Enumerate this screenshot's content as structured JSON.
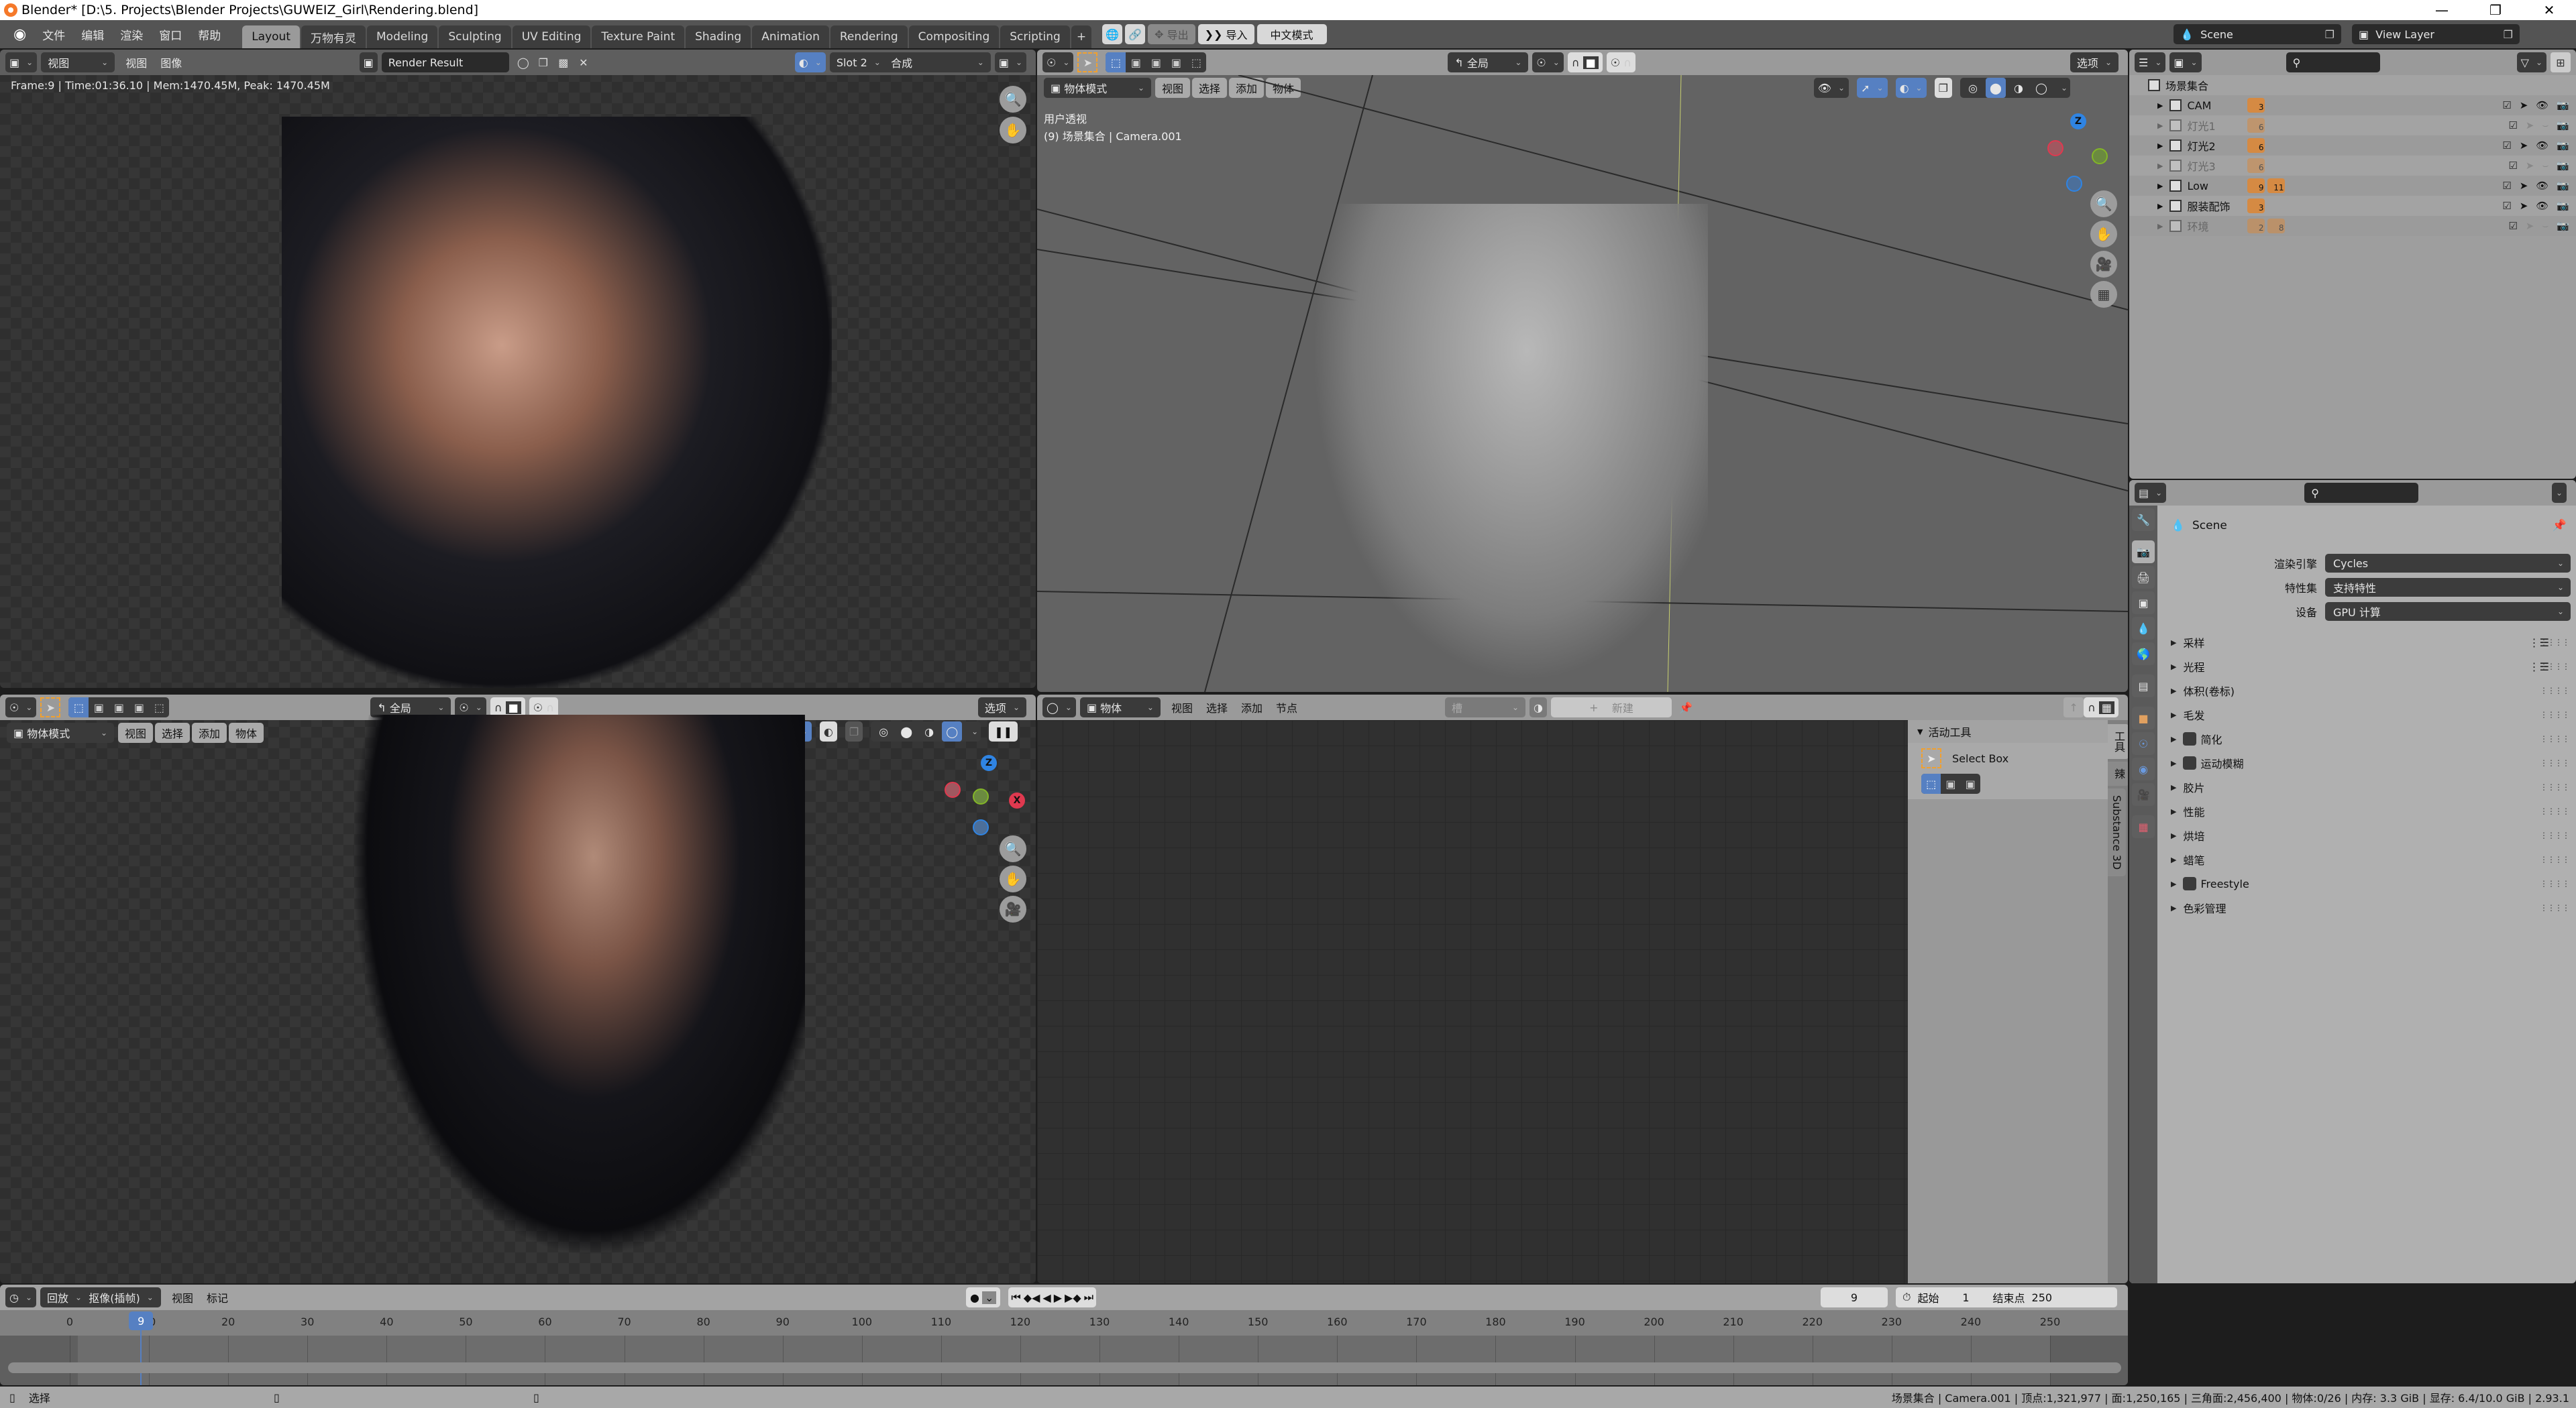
{
  "window": {
    "title": "Blender* [D:\\5. Projects\\Blender Projects\\GUWEIZ_Girl\\Rendering.blend]",
    "controls": [
      "minimize",
      "restore",
      "close"
    ]
  },
  "topbar": {
    "menus": [
      "文件",
      "编辑",
      "渲染",
      "窗口",
      "帮助"
    ],
    "workspaces": [
      "Layout",
      "万物有灵",
      "Modeling",
      "Sculpting",
      "UV Editing",
      "Texture Paint",
      "Shading",
      "Animation",
      "Rendering",
      "Compositing",
      "Scripting"
    ],
    "active_workspace": "Layout",
    "add_tab": "+",
    "export_label": "导出",
    "import_label": "导入",
    "chinese_mode_label": "中文模式",
    "scene": "Scene",
    "view_layer": "View Layer"
  },
  "image_editor": {
    "view_mode": "视图",
    "menus": [
      "视图",
      "图像"
    ],
    "image_name": "Render Result",
    "slot": "Slot 2",
    "layer": "合成",
    "render_info": "Frame:9 | Time:01:36.10 | Mem:1470.45M, Peak: 1470.45M"
  },
  "viewport_top": {
    "orientation": "全局",
    "options_label": "选项",
    "mode": "物体模式",
    "menus": [
      "视图",
      "选择",
      "添加",
      "物体"
    ],
    "view_name": "用户透视",
    "view_info": "(9) 场景集合 | Camera.001",
    "gizmo_axes": [
      "Z",
      "X",
      "Y"
    ]
  },
  "viewport_bottom": {
    "orientation": "全局",
    "options_label": "选项",
    "mode": "物体模式",
    "menus": [
      "视图",
      "选择",
      "添加",
      "物体"
    ],
    "gizmo_axes": [
      "Z",
      "X",
      "Y"
    ]
  },
  "shader_editor": {
    "type": "物体",
    "menus": [
      "视图",
      "选择",
      "添加",
      "节点"
    ],
    "slot_placeholder": "槽",
    "new_label": "新建",
    "sidebar": {
      "panel_title": "活动工具",
      "tool_name": "Select Box",
      "tabs": [
        "工具",
        "辣",
        "Substance 3D"
      ]
    }
  },
  "outliner": {
    "root": "场景集合",
    "rows": [
      {
        "name": "CAM",
        "dim": false,
        "badges": [
          "3"
        ]
      },
      {
        "name": "灯光1",
        "dim": true,
        "badges": [
          "6"
        ]
      },
      {
        "name": "灯光2",
        "dim": false,
        "badges": [
          "6"
        ]
      },
      {
        "name": "灯光3",
        "dim": true,
        "badges": [
          "6"
        ]
      },
      {
        "name": "Low",
        "dim": false,
        "badges": [
          "9",
          "11"
        ]
      },
      {
        "name": "服装配饰",
        "dim": false,
        "badges": [
          "3"
        ]
      },
      {
        "name": "环境",
        "dim": true,
        "badges": [
          "2",
          "8"
        ]
      }
    ]
  },
  "properties": {
    "context": "Scene",
    "fields": [
      {
        "label": "渲染引擎",
        "value": "Cycles"
      },
      {
        "label": "特性集",
        "value": "支持特性"
      },
      {
        "label": "设备",
        "value": "GPU 计算"
      }
    ],
    "panels": [
      {
        "label": "采样",
        "checkbox": false,
        "presets": true
      },
      {
        "label": "光程",
        "checkbox": false,
        "presets": true
      },
      {
        "label": "体积(卷标)",
        "checkbox": false,
        "presets": false
      },
      {
        "label": "毛发",
        "checkbox": false,
        "presets": false
      },
      {
        "label": "简化",
        "checkbox": true,
        "presets": false
      },
      {
        "label": "运动模糊",
        "checkbox": true,
        "presets": false
      },
      {
        "label": "胶片",
        "checkbox": false,
        "presets": false
      },
      {
        "label": "性能",
        "checkbox": false,
        "presets": false
      },
      {
        "label": "烘培",
        "checkbox": false,
        "presets": false
      },
      {
        "label": "蜡笔",
        "checkbox": false,
        "presets": false
      },
      {
        "label": "Freestyle",
        "checkbox": true,
        "presets": false
      },
      {
        "label": "色彩管理",
        "checkbox": false,
        "presets": false
      }
    ]
  },
  "timeline": {
    "playback": "回放",
    "keying": "抠像(插帧)",
    "menus": [
      "视图",
      "标记"
    ],
    "current_frame": "9",
    "start_label": "起始",
    "start": "1",
    "end_label": "结束点",
    "end": "250",
    "ticks": [
      "0",
      "10",
      "20",
      "30",
      "40",
      "50",
      "60",
      "70",
      "80",
      "90",
      "100",
      "110",
      "120",
      "130",
      "140",
      "150",
      "160",
      "170",
      "180",
      "190",
      "200",
      "210",
      "220",
      "230",
      "240",
      "250"
    ]
  },
  "statusbar": {
    "left_hint": "选择",
    "stats": "场景集合 | Camera.001 | 顶点:1,321,977 | 面:1,250,165 | 三角面:2,456,400 | 物体:0/26 | 内存: 3.3 GiB | 显存: 6.4/10.0 GiB | 2.93.1"
  },
  "colors": {
    "accent_blue": "#5680c2",
    "orange": "#f5792a",
    "axis_x": "#e0394f",
    "axis_y": "#83b627",
    "axis_z": "#2f84e3"
  }
}
